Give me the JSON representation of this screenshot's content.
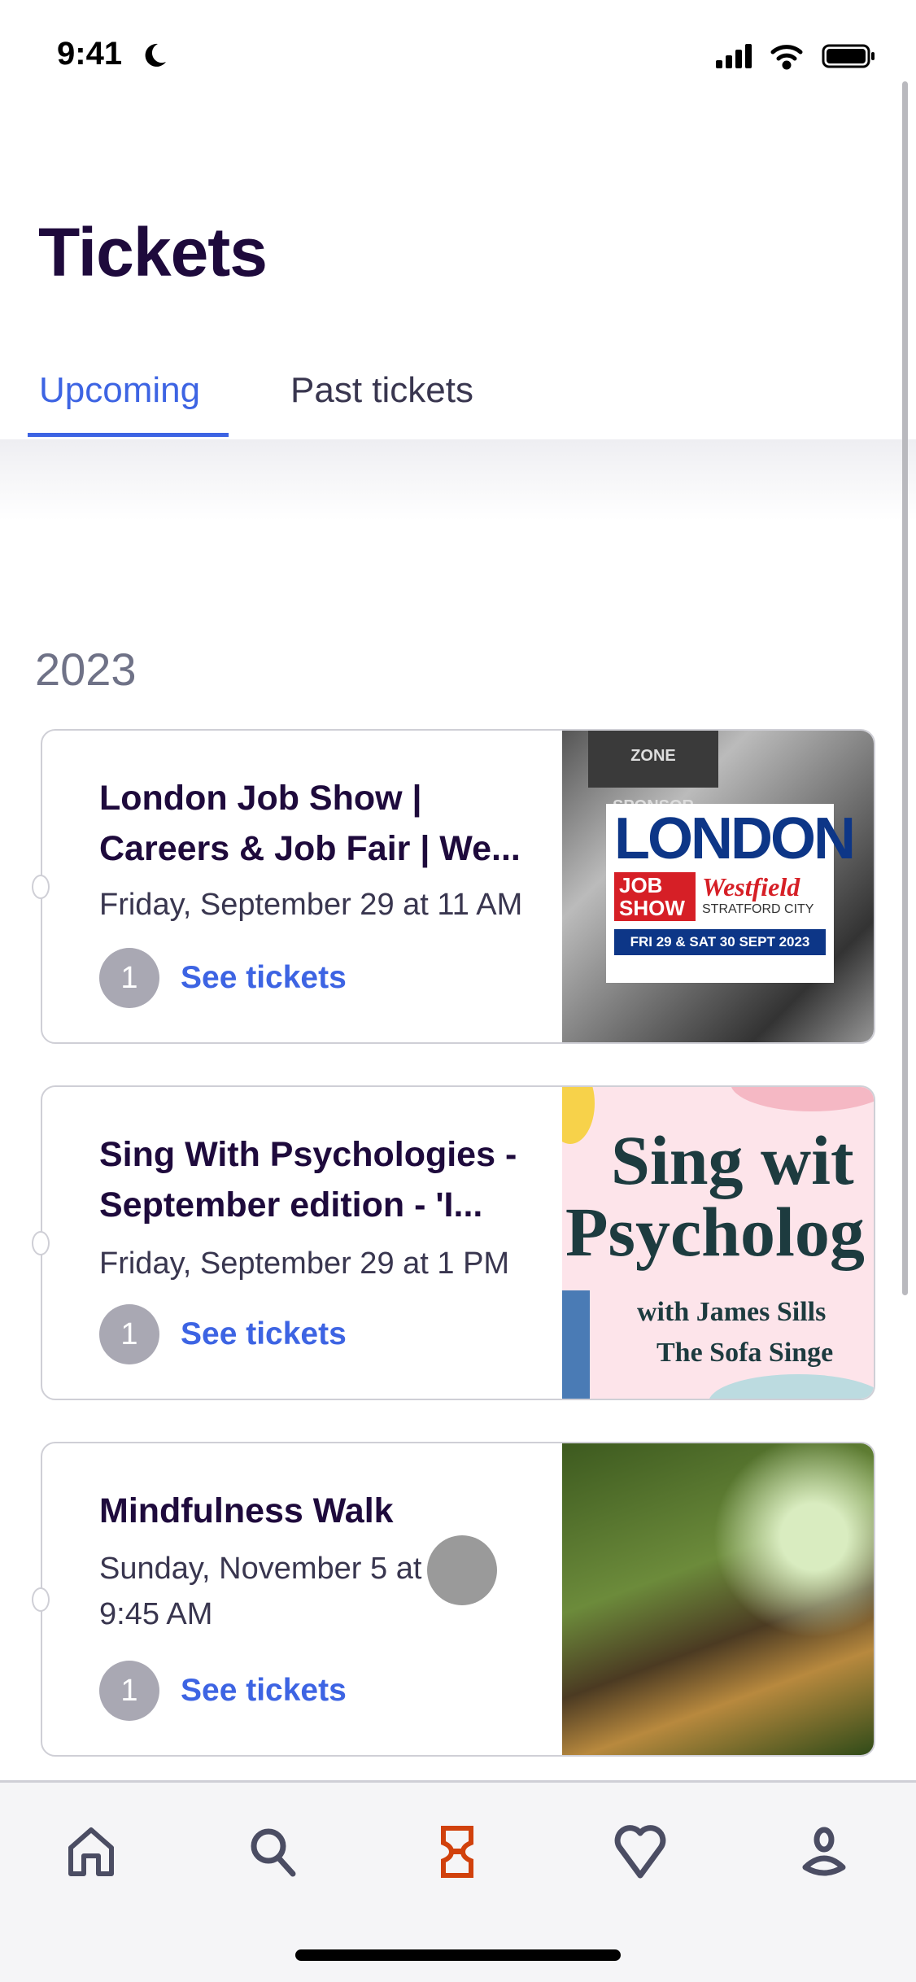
{
  "status_bar": {
    "time": "9:41",
    "moon_icon": "moon-icon",
    "signal_icon": "signal-icon",
    "wifi_icon": "wifi-icon",
    "battery_icon": "battery-icon"
  },
  "header": {
    "title": "Tickets"
  },
  "tabs": [
    {
      "label": "Upcoming",
      "active": true
    },
    {
      "label": "Past tickets",
      "active": false
    }
  ],
  "section": {
    "year": "2023"
  },
  "events": [
    {
      "title": "London Job Show | Careers & Job Fair | We...",
      "date": "Friday, September 29 at 11 AM",
      "ticket_count": "1",
      "action": "See tickets",
      "image_text": [
        "ZONE SPONSOR",
        "LONDON",
        "JOB SHOW",
        "Westfield",
        "STRATFORD CITY",
        "FRI 29 & SAT 30 SEPT 2023"
      ]
    },
    {
      "title": "Sing With Psychologies - September edition - 'I...",
      "date": "Friday, September 29 at 1 PM",
      "ticket_count": "1",
      "action": "See tickets",
      "image_text": [
        "Sing wit",
        "Psycholog",
        "with James Sills",
        "The Sofa Singe"
      ]
    },
    {
      "title": "Mindfulness Walk",
      "date": "Sunday, November 5 at 9:45 AM",
      "ticket_count": "1",
      "action": "See tickets"
    }
  ],
  "bottom_nav": [
    {
      "icon": "home-icon"
    },
    {
      "icon": "search-icon"
    },
    {
      "icon": "ticket-icon",
      "active": true
    },
    {
      "icon": "heart-icon"
    },
    {
      "icon": "profile-icon"
    }
  ],
  "colors": {
    "accent": "#3d64e3",
    "active_nav": "#d1410c",
    "title": "#1e0a3c",
    "icon": "#4b4d63"
  }
}
